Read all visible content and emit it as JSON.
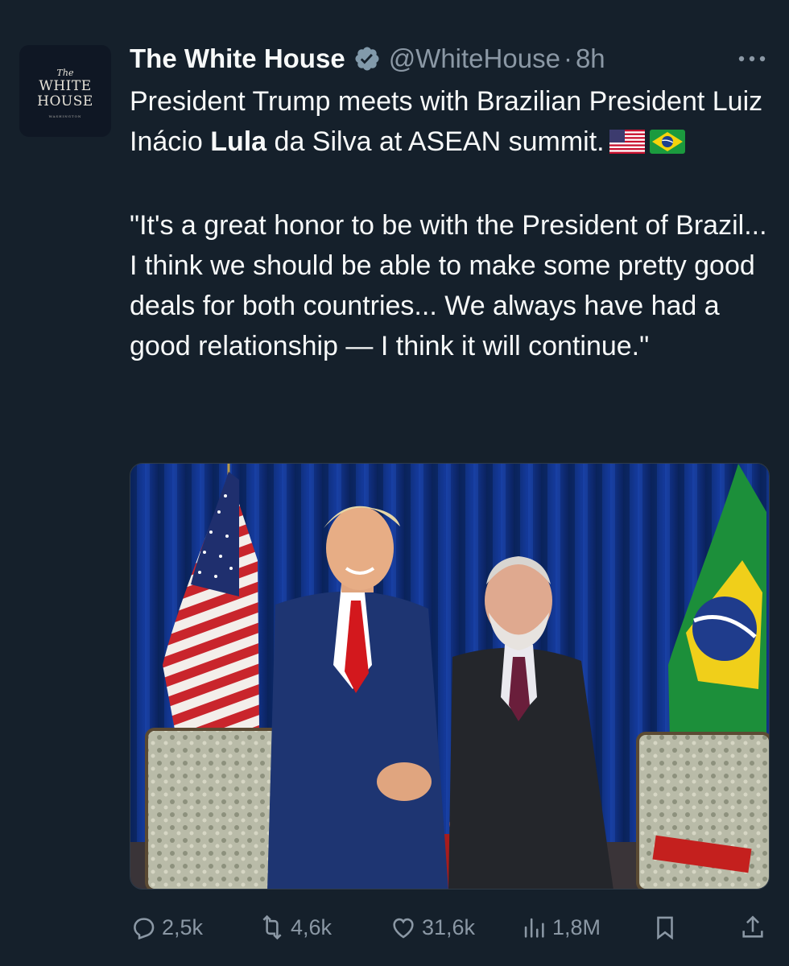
{
  "account": {
    "avatar_text": {
      "the": "The",
      "line1": "WHITE",
      "line2": "HOUSE",
      "sub": "WASHINGTON"
    },
    "display_name": "The White House",
    "handle": "@WhiteHouse",
    "separator": "·",
    "time": "8h"
  },
  "tweet": {
    "line1_pre": "President Trump meets with Brazilian President Luiz Inácio ",
    "line1_bold": "Lula",
    "line1_post": " da Silva at ASEAN summit.",
    "flags": [
      "us-flag-icon",
      "brazil-flag-icon"
    ],
    "quote": "\"It's a great honor to be with the President of Brazil... I think we should be able to make some pretty good deals for both countries... We always have had a good relationship — I think it will continue.\""
  },
  "media": {
    "description_icon": "photo"
  },
  "actions": {
    "replies": "2,5k",
    "reposts": "4,6k",
    "likes": "31,6k",
    "views": "1,8M"
  },
  "colors": {
    "background": "#15202b",
    "text": "#f7f9f9",
    "muted": "#8b98a5",
    "verified": "#829aab"
  }
}
